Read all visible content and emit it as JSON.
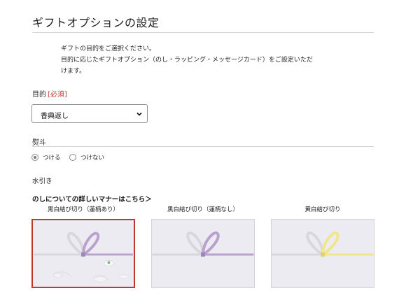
{
  "page": {
    "title": "ギフトオプションの設定",
    "intro_line1": "ギフトの目的をご選択ください。",
    "intro_line2": "目的に応じたギフトオプション（のし・ラッピング・メッセージカード）をご設定いただ",
    "intro_line3": "けます。"
  },
  "purpose": {
    "label": "目的",
    "required_badge": "[必須]",
    "selected_value": "香典返し"
  },
  "noshi": {
    "label": "熨斗",
    "options": [
      {
        "label": "つける",
        "checked": true
      },
      {
        "label": "つけない",
        "checked": false
      }
    ]
  },
  "mizuhiki": {
    "label": "水引き",
    "manner_link": "のしについての詳しいマナーはこちら＞",
    "cards": [
      {
        "caption": "黒白結び切り（蓮柄あり）",
        "selected": true,
        "cord_color": "#b9a0cf",
        "lotus": true
      },
      {
        "caption": "黒白結び切り（蓮柄なし）",
        "selected": false,
        "cord_color": "#b9a0cf",
        "lotus": false
      },
      {
        "caption": "黄白結び切り",
        "selected": false,
        "cord_color": "#f1e68c",
        "lotus": false
      }
    ]
  },
  "colors": {
    "accent_red": "#c0392b",
    "card_bg": "#ecebf1",
    "white_cord": "#d8d8dc"
  }
}
